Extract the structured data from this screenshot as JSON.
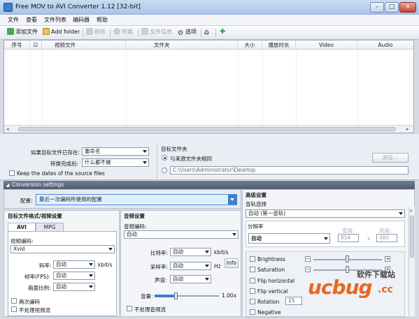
{
  "window": {
    "title": "Free MOV to AVI Converter 1.12  [32-bit]",
    "min": "–",
    "max": "□",
    "close": "×"
  },
  "menu": [
    "文件",
    "查看",
    "文件列表",
    "编码器",
    "帮助"
  ],
  "toolbar": {
    "add_file": "添加文件",
    "add_folder": "Add folder",
    "remove": "移除",
    "convert": "转换",
    "file_info": "文件信息",
    "options": "选项"
  },
  "grid": {
    "headers": [
      "序号",
      "☑",
      "视频文件",
      "文件夹",
      "大小",
      "播放时长",
      "Video",
      "Audio"
    ]
  },
  "options": {
    "exists_label": "如果目标文件已存在:",
    "exists_value": "重命名",
    "after_label": "转换完成后:",
    "after_value": "什么都不做",
    "keep_dates": "Keep the dates of the source files",
    "target_folder_title": "目标文件夹",
    "same_as_source": "与来源文件夹相同",
    "folder_path": "C:\\Users\\Administrator\\Desktop",
    "browse": "浏览..."
  },
  "conversion": {
    "section": "Conversion settings",
    "config_label": "配置:",
    "config_value": "最近一次编码所使用的配置"
  },
  "video": {
    "title": "目标文件格式/视频设置",
    "tab_avi": "AVI",
    "tab_mpg": "MPG",
    "codec_label": "视频编码:",
    "codec_value": "Xvid",
    "bitrate_label": "码率:",
    "bitrate_value": "自动",
    "bitrate_unit": "kbit/s",
    "fps_label": "帧率(FPS):",
    "fps_value": "自动",
    "aspect_label": "画面比例:",
    "aspect_value": "自动",
    "two_pass": "两次编码",
    "no_video": "不处理视频流"
  },
  "audio": {
    "title": "音频设置",
    "codec_label": "音频编码:",
    "codec_value": "自动",
    "bitrate_label": "比特率:",
    "bitrate_value": "自动",
    "bitrate_unit": "kbit/s",
    "samplerate_label": "采样率:",
    "samplerate_value": "自动",
    "samplerate_unit": "Hz",
    "info": "Info",
    "channels_label": "声道:",
    "channels_value": "自动",
    "volume_label": "音量:",
    "volume_value": "1.00x",
    "no_audio": "不处理音频流"
  },
  "advanced": {
    "title": "高级设置",
    "track_label": "音轨选择",
    "track_value": "自动 (第一音轨)",
    "resolution_label": "分辨率",
    "resolution_value": "自动",
    "width_label": "宽度:",
    "height_label": "高度:",
    "width_value": "854",
    "height_value": "480",
    "x": "x",
    "brightness": "Brightness",
    "saturation": "Saturation",
    "flip_h": "Flip horizontal",
    "flip_v": "Flip vertical",
    "rotation": "Rotation",
    "rotation_value": "15",
    "negative": "Negative"
  },
  "watermark": {
    "brand": "ucbug",
    "domain": ".cc",
    "tagline": "软件下载站"
  }
}
